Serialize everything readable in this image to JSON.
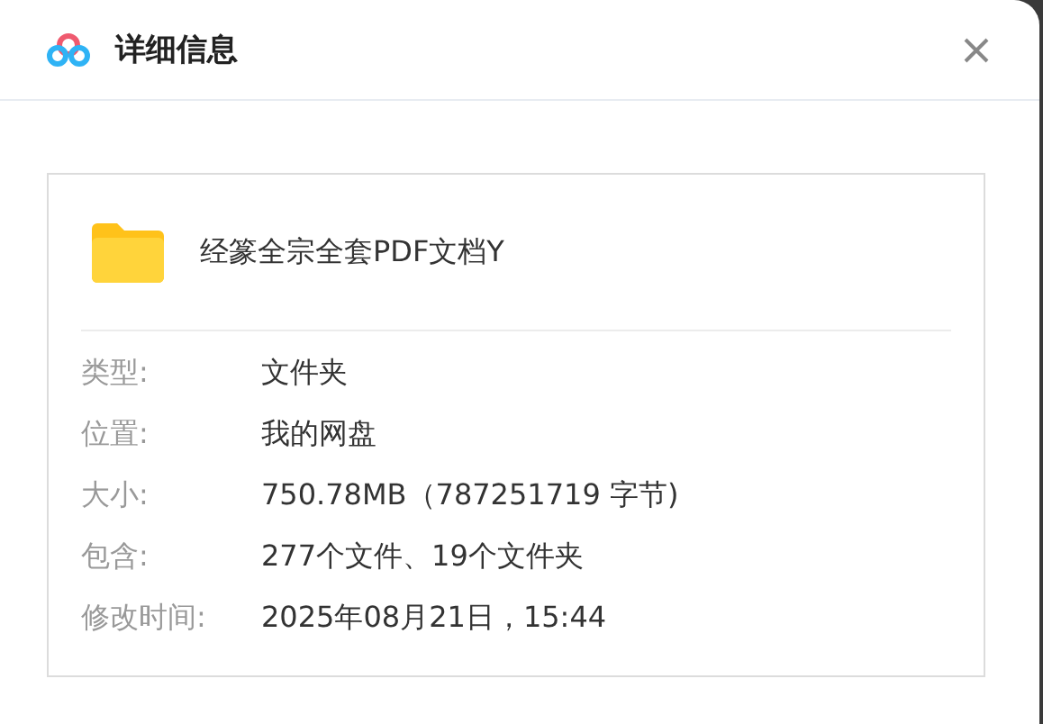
{
  "window": {
    "title": "详细信息"
  },
  "file": {
    "name": "经篆全宗全套PDF文档Y"
  },
  "details": [
    {
      "label": "类型:",
      "value": "文件夹"
    },
    {
      "label": "位置:",
      "value": "我的网盘"
    },
    {
      "label": "大小:",
      "value": "750.78MB（787251719 字节)"
    },
    {
      "label": "包含:",
      "value": "277个文件、19个文件夹"
    },
    {
      "label": "修改时间:",
      "value": "2025年08月21日，15:44"
    }
  ]
}
